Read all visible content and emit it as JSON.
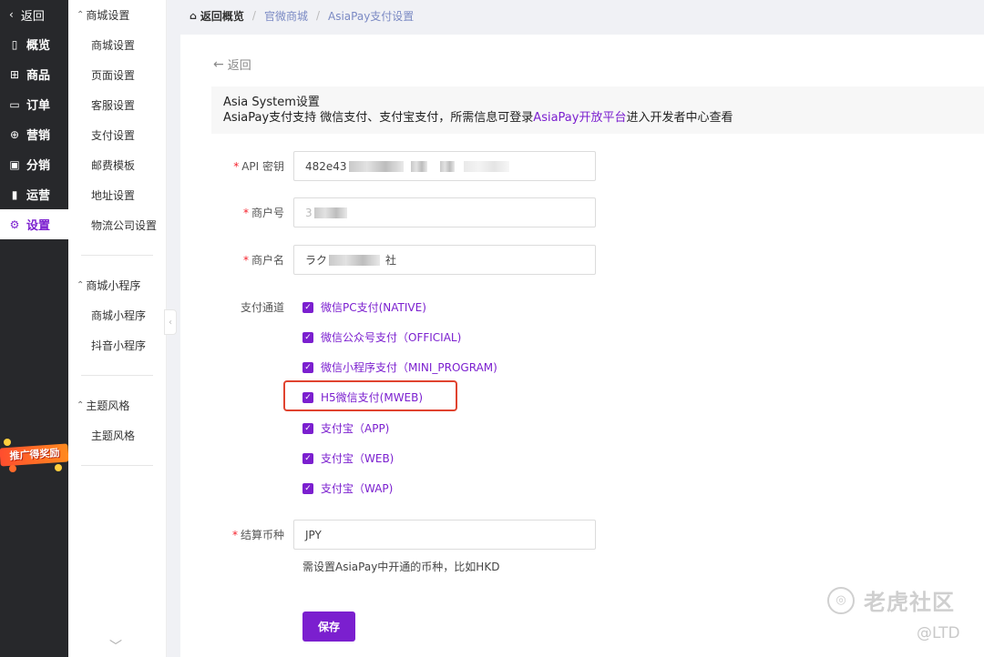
{
  "nav": {
    "back_label": "返回",
    "items": [
      {
        "label": "概览",
        "icon": "overview-icon",
        "glyph": "▯"
      },
      {
        "label": "商品",
        "icon": "product-icon",
        "glyph": "⊞"
      },
      {
        "label": "订单",
        "icon": "order-icon",
        "glyph": "▭"
      },
      {
        "label": "营销",
        "icon": "marketing-icon",
        "glyph": "⊕"
      },
      {
        "label": "分销",
        "icon": "distribution-icon",
        "glyph": "▣"
      },
      {
        "label": "运营",
        "icon": "operations-icon",
        "glyph": "▮"
      },
      {
        "label": "设置",
        "icon": "settings-icon",
        "glyph": "⚙"
      }
    ],
    "promo_text": "推广得奖励"
  },
  "submenu": {
    "groups": [
      {
        "title": "商城设置",
        "items": [
          "商城设置",
          "页面设置",
          "客服设置",
          "支付设置",
          "邮费模板",
          "地址设置",
          "物流公司设置"
        ]
      },
      {
        "title": "商城小程序",
        "items": [
          "商城小程序",
          "抖音小程序"
        ]
      },
      {
        "title": "主题风格",
        "items": [
          "主题风格"
        ]
      }
    ]
  },
  "breadcrumb": {
    "home": "返回概览",
    "crumbs": [
      "官微商城",
      "AsiaPay支付设置"
    ]
  },
  "panel": {
    "back_label": "返回",
    "info_title": "Asia System设置",
    "info_desc_prefix": "AsiaPay支付支持 微信支付、支付宝支付，所需信息可登录",
    "info_desc_link": "AsiaPay开放平台",
    "info_desc_suffix": "进入开发者中心查看"
  },
  "form": {
    "api_key": {
      "label": "API 密钥",
      "value": "482e43"
    },
    "merchant_id": {
      "label": "商户号",
      "value": "3"
    },
    "merchant_name": {
      "label": "商户名",
      "value_prefix": "ラク",
      "value_suffix": "社"
    },
    "channels_label": "支付通道",
    "channels": [
      {
        "label": "微信PC支付(NATIVE)",
        "checked": true
      },
      {
        "label": "微信公众号支付（OFFICIAL)",
        "checked": true
      },
      {
        "label": "微信小程序支付（MINI_PROGRAM)",
        "checked": true
      },
      {
        "label": "H5微信支付(MWEB)",
        "checked": true
      },
      {
        "label": "支付宝（APP)",
        "checked": true
      },
      {
        "label": "支付宝（WEB)",
        "checked": true
      },
      {
        "label": "支付宝（WAP)",
        "checked": true
      }
    ],
    "currency": {
      "label": "结算币种",
      "value": "JPY"
    },
    "currency_hint": "需设置AsiaPay中开通的币种，比如HKD",
    "save_label": "保存"
  },
  "watermark": {
    "title": "老虎社区",
    "handle": "@LTD"
  },
  "colors": {
    "accent": "#7b1fcf",
    "nav_bg": "#27282b",
    "highlight": "#e0432f"
  }
}
